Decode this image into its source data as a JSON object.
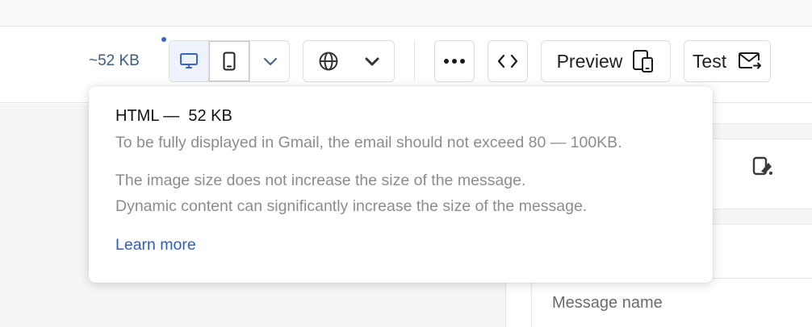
{
  "toolbar": {
    "size_estimate": "~52 KB",
    "preview_label": "Preview",
    "test_label": "Test"
  },
  "tooltip": {
    "title": "HTML —  52 KB",
    "gmail_note": "To be fully displayed in Gmail, the email should not exceed 80 — 100KB.",
    "image_note": "The image size does not increase the size of the message.",
    "dynamic_note": "Dynamic content can significantly increase the size of the message.",
    "learn_more": "Learn more"
  },
  "panel": {
    "message_name_placeholder": "Message name"
  },
  "icons": {
    "desktop": "desktop-icon",
    "mobile": "mobile-icon",
    "chevron": "chevron-down-icon",
    "globe": "globe-icon",
    "more": "more-horizontal-icon",
    "code": "code-icon",
    "preview": "devices-icon",
    "test": "mail-send-icon",
    "style": "paint-bucket-icon"
  },
  "colors": {
    "accent": "#3b63c4",
    "link": "#2f5db3",
    "muted_text": "#8c8c8c",
    "active_segment": "#eef2fa"
  }
}
